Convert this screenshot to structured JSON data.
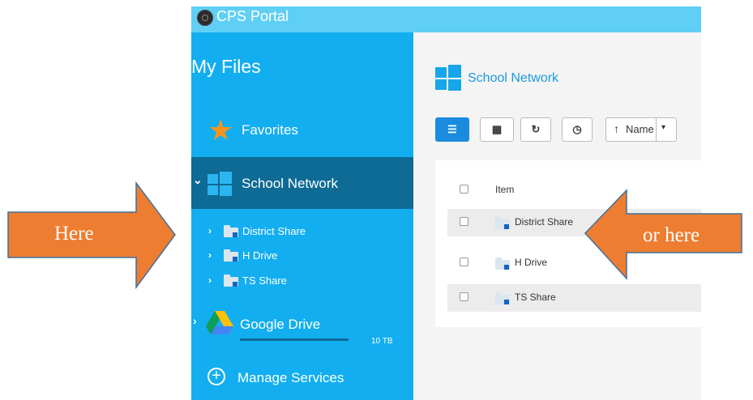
{
  "app": {
    "title": "CPS Portal"
  },
  "sidebar": {
    "title": "My Files",
    "favorites": {
      "label": "Favorites",
      "icon": "star-icon"
    },
    "school_network": {
      "label": "School Network",
      "icon": "windows-icon"
    },
    "tree": [
      {
        "label": "District Share"
      },
      {
        "label": "H Drive"
      },
      {
        "label": "TS Share"
      }
    ],
    "google_drive": {
      "label": "Google Drive",
      "size": "10 TB",
      "icon": "google-drive-icon"
    },
    "manage_services": {
      "label": "Manage Services",
      "icon": "plus-circle-icon"
    }
  },
  "main": {
    "header": "School Network",
    "toolbar": {
      "buttons": [
        "list-view-icon",
        "grid-view-icon",
        "refresh-icon",
        "recent-icon"
      ],
      "sort_label": "Name"
    },
    "list": {
      "header": "Item",
      "rows": [
        {
          "label": "District Share"
        },
        {
          "label": "H Drive"
        },
        {
          "label": "TS Share"
        }
      ]
    }
  },
  "annotations": {
    "left_arrow": "Here",
    "right_arrow": "or here"
  },
  "colors": {
    "titlebar": "#5fcff6",
    "sidebar": "#12aef0",
    "sidebar_selected": "#0e6b95",
    "accent": "#1a8bde",
    "arrow_fill": "#ed7d31",
    "arrow_stroke": "#41719c"
  }
}
